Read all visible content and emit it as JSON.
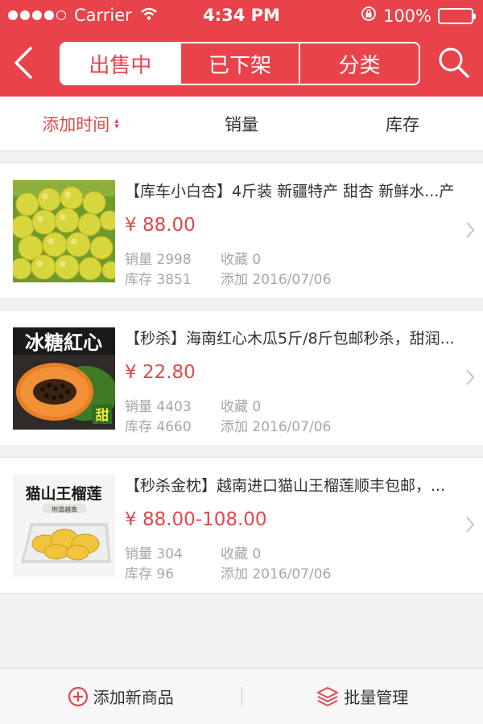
{
  "status_bar": {
    "carrier": "Carrier",
    "time": "4:34 PM",
    "battery": "100%"
  },
  "header": {
    "tabs": [
      {
        "label": "出售中",
        "active": true
      },
      {
        "label": "已下架",
        "active": false
      },
      {
        "label": "分类",
        "active": false
      }
    ],
    "accent_color": "#e8434a"
  },
  "sort_bar": {
    "options": [
      {
        "label": "添加时间",
        "active": true
      },
      {
        "label": "销量",
        "active": false
      },
      {
        "label": "库存",
        "active": false
      }
    ]
  },
  "products": [
    {
      "title": "【库车小白杏】4斤装 新疆特产 甜杏 新鲜水...产",
      "price": "¥ 88.00",
      "sales": "销量 2998",
      "favorites": "收藏 0",
      "stock": "库存 3851",
      "added": "添加 2016/07/06",
      "image": "apricots"
    },
    {
      "title": "【秒杀】海南红心木瓜5斤/8斤包邮秒杀，甜润...",
      "price": "¥ 22.80",
      "sales": "销量 4403",
      "favorites": "收藏 0",
      "stock": "库存 4660",
      "added": "添加 2016/07/06",
      "image": "papaya",
      "image_text": [
        "冰糖紅心",
        "甜"
      ]
    },
    {
      "title": "【秒杀金枕】越南进口猫山王榴莲顺丰包邮，...",
      "price": "¥ 88.00-108.00",
      "sales": "销量 304",
      "favorites": "收藏 0",
      "stock": "库存 96",
      "added": "添加 2016/07/06",
      "image": "durian",
      "image_text": [
        "猫山王榴莲",
        "地道越南"
      ]
    }
  ],
  "bottom_bar": {
    "add_label": "添加新商品",
    "batch_label": "批量管理"
  }
}
